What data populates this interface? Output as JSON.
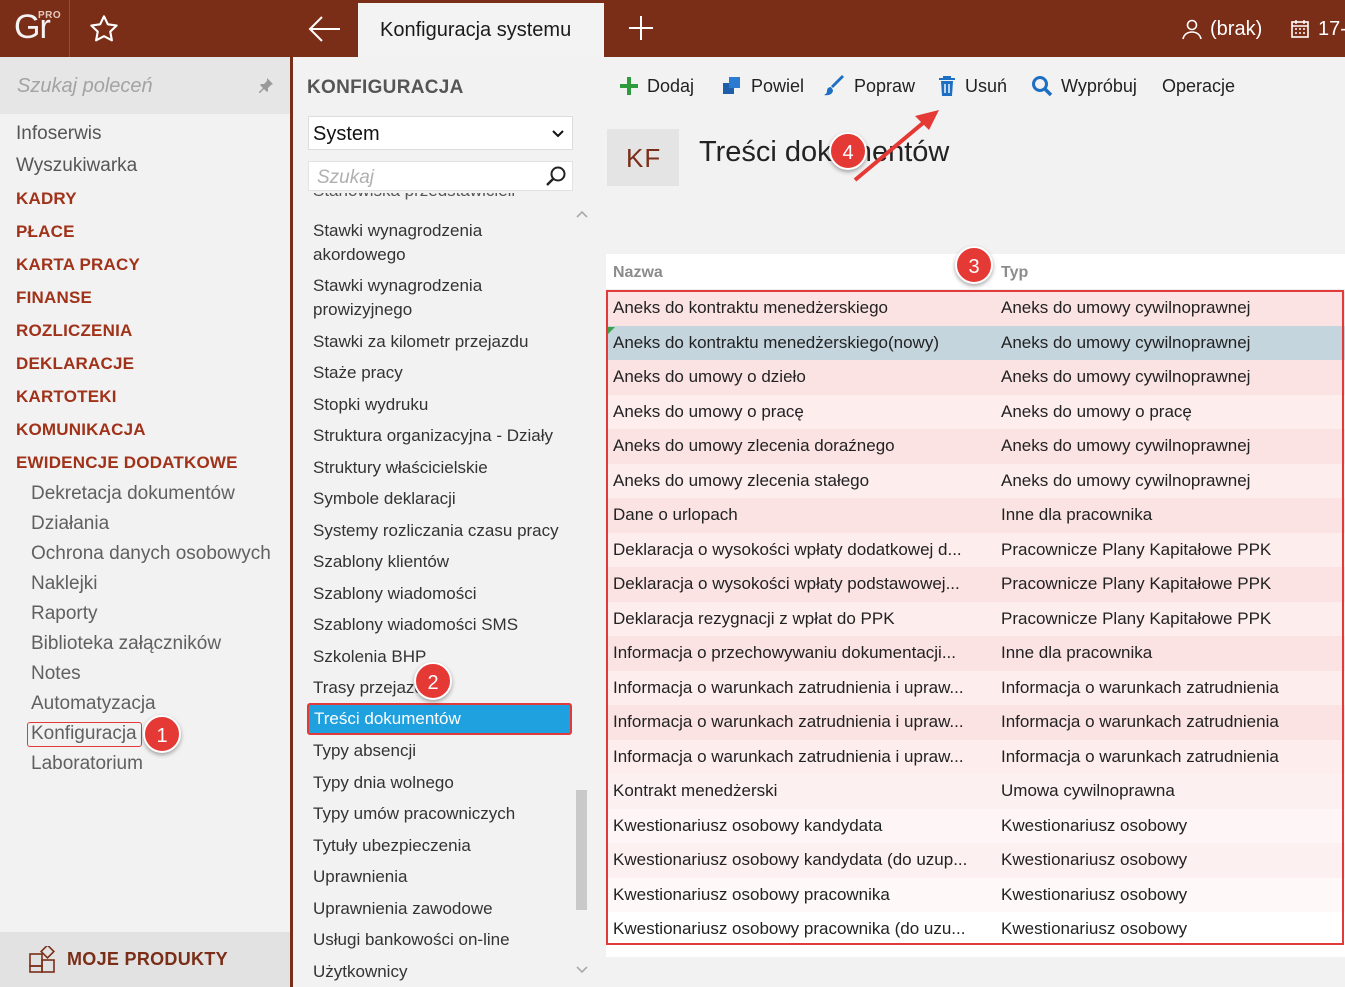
{
  "app": {
    "logo_text": "Gr",
    "logo_badge": "PRO",
    "active_tab": "Konfiguracja systemu",
    "user": "(brak)",
    "date_partial": "17-"
  },
  "leftnav": {
    "search_placeholder": "Szukaj poleceń",
    "plain_items": [
      "Infoserwis",
      "Wyszukiwarka"
    ],
    "sections": [
      "KADRY",
      "PŁACE",
      "KARTA PRACY",
      "FINANSE",
      "ROZLICZENIA",
      "DEKLARACJE",
      "KARTOTEKI",
      "KOMUNIKACJA",
      "EWIDENCJE DODATKOWE"
    ],
    "sub_items": [
      "Dekretacja dokumentów",
      "Działania",
      "Ochrona danych osobowych",
      "Naklejki",
      "Raporty",
      "Biblioteka załączników",
      "Notes",
      "Automatyzacja",
      "Konfiguracja",
      "Laboratorium"
    ],
    "footer": "MOJE PRODUKTY"
  },
  "config": {
    "title": "KONFIGURACJA",
    "select_value": "System",
    "search_placeholder": "Szukaj",
    "partial_top": "Stanowiska przedstawicieli",
    "items": [
      "Stawki wynagrodzenia akordowego",
      "Stawki wynagrodzenia prowizyjnego",
      "Stawki za kilometr przejazdu",
      "Staże pracy",
      "Stopki wydruku",
      "Struktura organizacyjna - Działy",
      "Struktury właścicielskie",
      "Symbole deklaracji",
      "Systemy rozliczania czasu pracy",
      "Szablony klientów",
      "Szablony wiadomości",
      "Szablony wiadomości SMS",
      "Szkolenia BHP",
      "Trasy przejazdu",
      "Treści dokumentów",
      "Typy absencji",
      "Typy dnia wolnego",
      "Typy umów pracowniczych",
      "Tytuły ubezpieczenia",
      "Uprawnienia",
      "Uprawnienia zawodowe",
      "Usługi bankowości on-line",
      "Użytkownicy"
    ]
  },
  "toolbar": {
    "add": "Dodaj",
    "duplicate": "Powiel",
    "edit": "Popraw",
    "delete": "Usuń",
    "try": "Wypróbuj",
    "operations": "Operacje"
  },
  "page": {
    "badge": "KF",
    "title": "Treści dokumentów"
  },
  "grid": {
    "col_name": "Nazwa",
    "col_type": "Typ",
    "rows": [
      {
        "name": "Aneks do kontraktu menedżerskiego",
        "type": "Aneks do umowy cywilnoprawnej"
      },
      {
        "name": "Aneks do kontraktu menedżerskiego(nowy)",
        "type": "Aneks do umowy cywilnoprawnej"
      },
      {
        "name": "Aneks do umowy o dzieło",
        "type": "Aneks do umowy cywilnoprawnej"
      },
      {
        "name": "Aneks do umowy o pracę",
        "type": "Aneks do umowy o pracę"
      },
      {
        "name": "Aneks do umowy zlecenia doraźnego",
        "type": "Aneks do umowy cywilnoprawnej"
      },
      {
        "name": "Aneks do umowy zlecenia stałego",
        "type": "Aneks do umowy cywilnoprawnej"
      },
      {
        "name": "Dane o urlopach",
        "type": "Inne dla pracownika"
      },
      {
        "name": "Deklaracja o wysokości wpłaty dodatkowej d...",
        "type": "Pracownicze Plany Kapitałowe PPK"
      },
      {
        "name": "Deklaracja o wysokości wpłaty podstawowej...",
        "type": "Pracownicze Plany Kapitałowe PPK"
      },
      {
        "name": "Deklaracja rezygnacji z wpłat do PPK",
        "type": "Pracownicze Plany Kapitałowe PPK"
      },
      {
        "name": "Informacja o przechowywaniu dokumentacji...",
        "type": "Inne dla pracownika"
      },
      {
        "name": "Informacja o warunkach zatrudnienia i upraw...",
        "type": "Informacja o warunkach zatrudnienia"
      },
      {
        "name": "Informacja o warunkach zatrudnienia i upraw...",
        "type": "Informacja o warunkach zatrudnienia"
      },
      {
        "name": "Informacja o warunkach zatrudnienia i upraw...",
        "type": "Informacja o warunkach zatrudnienia"
      },
      {
        "name": "Kontrakt menedżerski",
        "type": "Umowa cywilnoprawna"
      },
      {
        "name": "Kwestionariusz osobowy kandydata",
        "type": "Kwestionariusz osobowy"
      },
      {
        "name": "Kwestionariusz osobowy kandydata (do uzup...",
        "type": "Kwestionariusz osobowy"
      },
      {
        "name": "Kwestionariusz osobowy pracownika",
        "type": "Kwestionariusz osobowy"
      },
      {
        "name": "Kwestionariusz osobowy pracownika (do uzu...",
        "type": "Kwestionariusz osobowy"
      }
    ]
  },
  "markers": [
    "1",
    "2",
    "3",
    "4"
  ],
  "colors": {
    "brand": "#7a2e18",
    "section_text": "#a0321a",
    "selected_item": "#1fa0df",
    "highlight_outline": "#e03a3a",
    "row_highlight": "#fbe3e3",
    "row_selected": "#c4d5de"
  }
}
